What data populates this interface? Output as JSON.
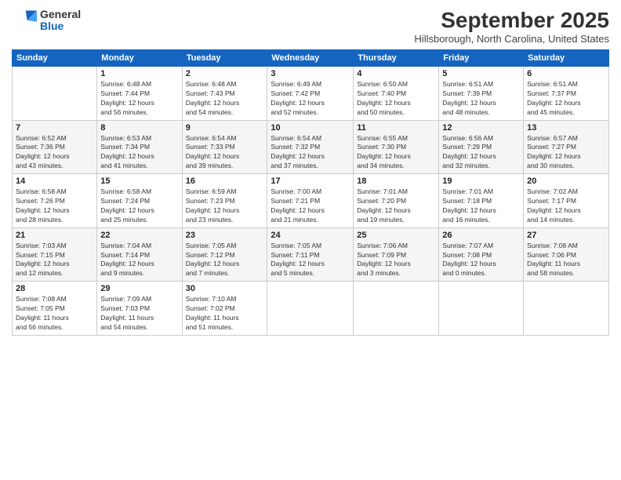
{
  "logo": {
    "general": "General",
    "blue": "Blue"
  },
  "header": {
    "month": "September 2025",
    "location": "Hillsborough, North Carolina, United States"
  },
  "weekdays": [
    "Sunday",
    "Monday",
    "Tuesday",
    "Wednesday",
    "Thursday",
    "Friday",
    "Saturday"
  ],
  "weeks": [
    [
      {
        "day": "",
        "info": ""
      },
      {
        "day": "1",
        "info": "Sunrise: 6:48 AM\nSunset: 7:44 PM\nDaylight: 12 hours\nand 56 minutes."
      },
      {
        "day": "2",
        "info": "Sunrise: 6:48 AM\nSunset: 7:43 PM\nDaylight: 12 hours\nand 54 minutes."
      },
      {
        "day": "3",
        "info": "Sunrise: 6:49 AM\nSunset: 7:42 PM\nDaylight: 12 hours\nand 52 minutes."
      },
      {
        "day": "4",
        "info": "Sunrise: 6:50 AM\nSunset: 7:40 PM\nDaylight: 12 hours\nand 50 minutes."
      },
      {
        "day": "5",
        "info": "Sunrise: 6:51 AM\nSunset: 7:39 PM\nDaylight: 12 hours\nand 48 minutes."
      },
      {
        "day": "6",
        "info": "Sunrise: 6:51 AM\nSunset: 7:37 PM\nDaylight: 12 hours\nand 45 minutes."
      }
    ],
    [
      {
        "day": "7",
        "info": "Sunrise: 6:52 AM\nSunset: 7:36 PM\nDaylight: 12 hours\nand 43 minutes."
      },
      {
        "day": "8",
        "info": "Sunrise: 6:53 AM\nSunset: 7:34 PM\nDaylight: 12 hours\nand 41 minutes."
      },
      {
        "day": "9",
        "info": "Sunrise: 6:54 AM\nSunset: 7:33 PM\nDaylight: 12 hours\nand 39 minutes."
      },
      {
        "day": "10",
        "info": "Sunrise: 6:54 AM\nSunset: 7:32 PM\nDaylight: 12 hours\nand 37 minutes."
      },
      {
        "day": "11",
        "info": "Sunrise: 6:55 AM\nSunset: 7:30 PM\nDaylight: 12 hours\nand 34 minutes."
      },
      {
        "day": "12",
        "info": "Sunrise: 6:56 AM\nSunset: 7:29 PM\nDaylight: 12 hours\nand 32 minutes."
      },
      {
        "day": "13",
        "info": "Sunrise: 6:57 AM\nSunset: 7:27 PM\nDaylight: 12 hours\nand 30 minutes."
      }
    ],
    [
      {
        "day": "14",
        "info": "Sunrise: 6:58 AM\nSunset: 7:26 PM\nDaylight: 12 hours\nand 28 minutes."
      },
      {
        "day": "15",
        "info": "Sunrise: 6:58 AM\nSunset: 7:24 PM\nDaylight: 12 hours\nand 25 minutes."
      },
      {
        "day": "16",
        "info": "Sunrise: 6:59 AM\nSunset: 7:23 PM\nDaylight: 12 hours\nand 23 minutes."
      },
      {
        "day": "17",
        "info": "Sunrise: 7:00 AM\nSunset: 7:21 PM\nDaylight: 12 hours\nand 21 minutes."
      },
      {
        "day": "18",
        "info": "Sunrise: 7:01 AM\nSunset: 7:20 PM\nDaylight: 12 hours\nand 19 minutes."
      },
      {
        "day": "19",
        "info": "Sunrise: 7:01 AM\nSunset: 7:18 PM\nDaylight: 12 hours\nand 16 minutes."
      },
      {
        "day": "20",
        "info": "Sunrise: 7:02 AM\nSunset: 7:17 PM\nDaylight: 12 hours\nand 14 minutes."
      }
    ],
    [
      {
        "day": "21",
        "info": "Sunrise: 7:03 AM\nSunset: 7:15 PM\nDaylight: 12 hours\nand 12 minutes."
      },
      {
        "day": "22",
        "info": "Sunrise: 7:04 AM\nSunset: 7:14 PM\nDaylight: 12 hours\nand 9 minutes."
      },
      {
        "day": "23",
        "info": "Sunrise: 7:05 AM\nSunset: 7:12 PM\nDaylight: 12 hours\nand 7 minutes."
      },
      {
        "day": "24",
        "info": "Sunrise: 7:05 AM\nSunset: 7:11 PM\nDaylight: 12 hours\nand 5 minutes."
      },
      {
        "day": "25",
        "info": "Sunrise: 7:06 AM\nSunset: 7:09 PM\nDaylight: 12 hours\nand 3 minutes."
      },
      {
        "day": "26",
        "info": "Sunrise: 7:07 AM\nSunset: 7:08 PM\nDaylight: 12 hours\nand 0 minutes."
      },
      {
        "day": "27",
        "info": "Sunrise: 7:08 AM\nSunset: 7:06 PM\nDaylight: 11 hours\nand 58 minutes."
      }
    ],
    [
      {
        "day": "28",
        "info": "Sunrise: 7:08 AM\nSunset: 7:05 PM\nDaylight: 11 hours\nand 56 minutes."
      },
      {
        "day": "29",
        "info": "Sunrise: 7:09 AM\nSunset: 7:03 PM\nDaylight: 11 hours\nand 54 minutes."
      },
      {
        "day": "30",
        "info": "Sunrise: 7:10 AM\nSunset: 7:02 PM\nDaylight: 11 hours\nand 51 minutes."
      },
      {
        "day": "",
        "info": ""
      },
      {
        "day": "",
        "info": ""
      },
      {
        "day": "",
        "info": ""
      },
      {
        "day": "",
        "info": ""
      }
    ]
  ]
}
